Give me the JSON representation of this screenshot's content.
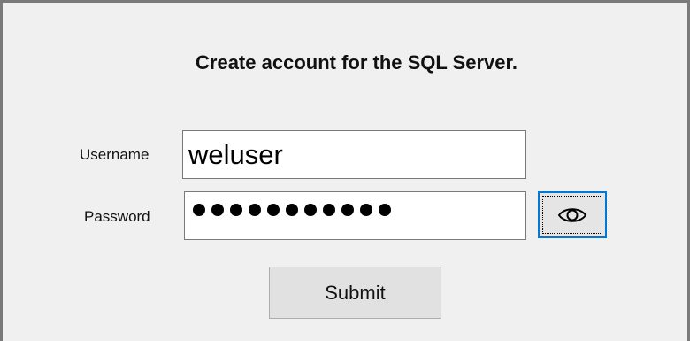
{
  "form": {
    "title": "Create account for the SQL Server.",
    "username_label": "Username",
    "username_value": "weluser",
    "password_label": "Password",
    "password_mask_count": 11,
    "show_password_icon": "eye-icon",
    "submit_label": "Submit"
  },
  "colors": {
    "window_bg": "#f0f0f0",
    "focus_border": "#0078d7",
    "button_bg": "#e1e1e1"
  }
}
